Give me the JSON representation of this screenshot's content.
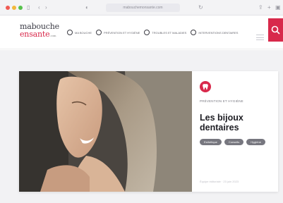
{
  "browser": {
    "url": "mabouchemonsante.com"
  },
  "header": {
    "logo_top": "mabouche",
    "logo_bottom": "ensante",
    "logo_suffix": ".com",
    "nav": [
      {
        "label": "MA BOUCHE",
        "icon": "mouth-icon"
      },
      {
        "label": "PRÉVENTION ET HYGIÈNE",
        "icon": "tooth-icon"
      },
      {
        "label": "TROUBLES ET MALADIES",
        "icon": "virus-icon"
      },
      {
        "label": "INTERVENTIONS DENTAIRES",
        "icon": "dental-tool-icon"
      }
    ]
  },
  "article": {
    "category": "PRÉVENTION ET HYGIÈNE",
    "title_line1": "Les bijoux",
    "title_line2": "dentaires",
    "tags": [
      "Esthétique",
      "Conseils",
      "Hygiène"
    ],
    "date": "Équipe éditoriale · 23 juin 2023"
  },
  "colors": {
    "accent": "#d8294b",
    "text": "#1e1e24",
    "tag_bg": "#77777f"
  }
}
